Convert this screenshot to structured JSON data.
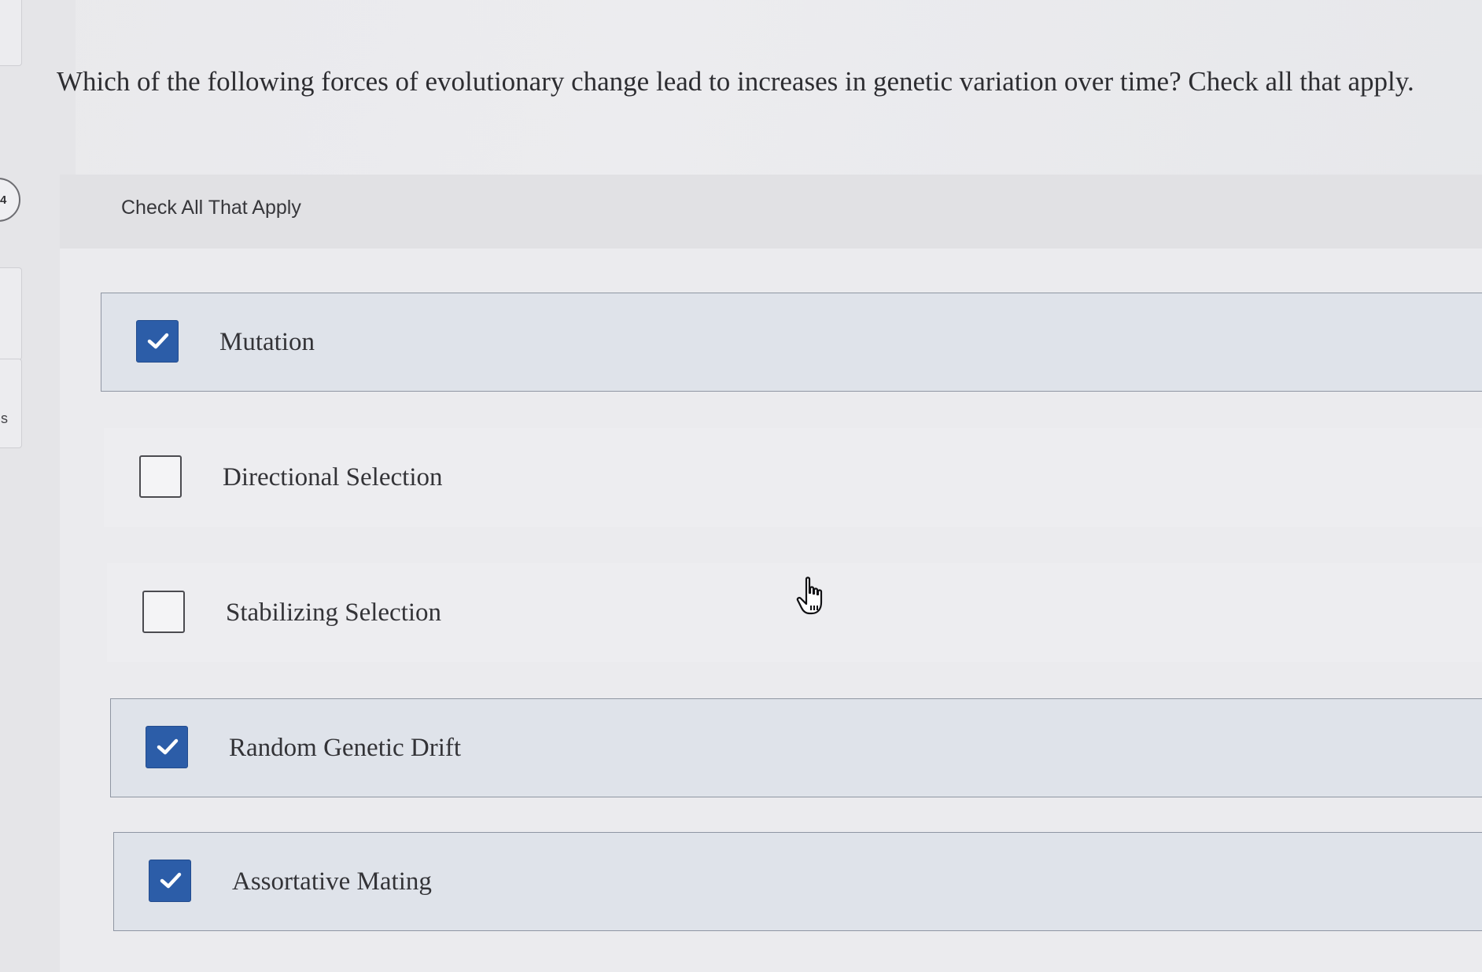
{
  "left_rail": {
    "number_badge": "4",
    "letter": "s"
  },
  "question": {
    "text": "Which of the following forces of evolutionary change lead to increases in genetic variation over time? Check all that apply."
  },
  "panel": {
    "header": "Check All That Apply",
    "options": [
      {
        "label": "Mutation",
        "checked": true
      },
      {
        "label": "Directional Selection",
        "checked": false
      },
      {
        "label": "Stabilizing Selection",
        "checked": false
      },
      {
        "label": "Random Genetic Drift",
        "checked": true
      },
      {
        "label": "Assortative Mating",
        "checked": true
      }
    ]
  },
  "colors": {
    "checkbox_checked": "#2c5da8",
    "option_checked_bg": "#dfe3ea"
  },
  "icons": {
    "checkmark": "checkmark-icon",
    "cursor": "hand-pointer-icon"
  }
}
